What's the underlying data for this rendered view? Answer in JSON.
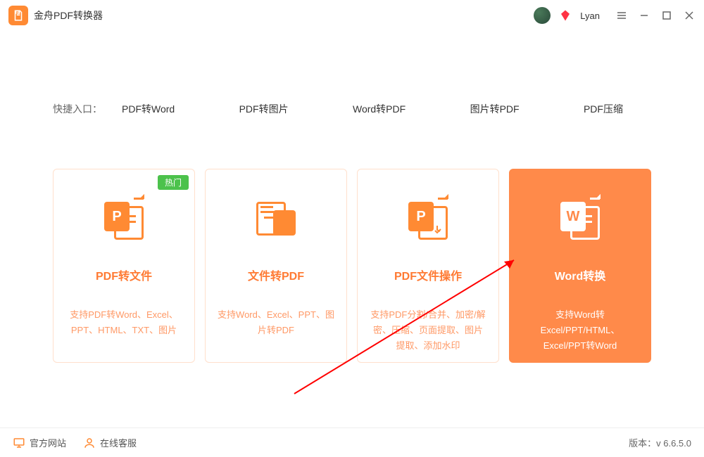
{
  "app": {
    "title": "金舟PDF转换器"
  },
  "user": {
    "name": "Lyan"
  },
  "quickEntry": {
    "label": "快捷入口：",
    "items": [
      "PDF转Word",
      "PDF转图片",
      "Word转PDF",
      "图片转PDF",
      "PDF压缩"
    ]
  },
  "cards": [
    {
      "badge": "热门",
      "title": "PDF转文件",
      "desc": "支持PDF转Word、Excel、PPT、HTML、TXT、图片",
      "iconLetter": "P"
    },
    {
      "title": "文件转PDF",
      "desc": "支持Word、Excel、PPT、图片转PDF",
      "iconLetter": ""
    },
    {
      "title": "PDF文件操作",
      "desc": "支持PDF分割/合并、加密/解密、压缩、页面提取、图片提取、添加水印",
      "iconLetter": "P"
    },
    {
      "title": "Word转换",
      "desc": "支持Word转Excel/PPT/HTML、Excel/PPT转Word",
      "iconLetter": "W"
    }
  ],
  "footer": {
    "officialSite": "官方网站",
    "onlineService": "在线客服",
    "versionLabel": "版本：",
    "version": "v 6.6.5.0"
  }
}
